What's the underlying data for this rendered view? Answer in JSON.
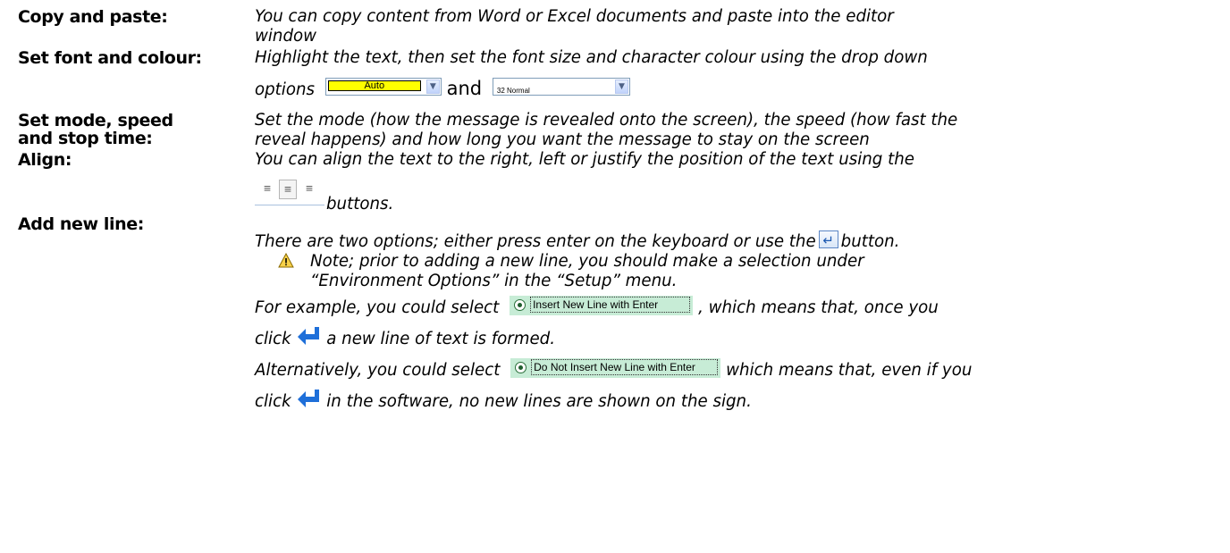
{
  "items": [
    {
      "term": "Copy and paste:",
      "desc1": "You can copy content from Word or Excel documents and paste into the editor",
      "desc2": "window"
    },
    {
      "term": "Set font and colour:",
      "desc1": "Highlight the text, then set the font size and character colour using the drop down",
      "desc2_a": "options",
      "desc2_and": "and"
    },
    {
      "term1": "Set mode, speed",
      "term2": "and stop time:",
      "desc1": "Set the mode (how the message is revealed onto the screen), the speed (how fast the",
      "desc2": "reveal happens) and how long you want the message to stay on the screen"
    },
    {
      "term": "Align:",
      "desc1": "You can align the text to the right, left or justify the position of the text using the",
      "desc2": "buttons."
    },
    {
      "term": "Add new line:",
      "desc1_a": "There are two options; either press enter on the keyboard or use the",
      "desc1_b": "button."
    }
  ],
  "controls": {
    "colour_dropdown_value": "Auto",
    "colour_dropdown_color": "#ffff00",
    "size_dropdown_value": "32 Normal",
    "align_icons": [
      "align-left-icon",
      "align-center-icon",
      "align-right-icon"
    ]
  },
  "note": {
    "line1": "Note; prior to adding a new line, you should make a selection under",
    "line2": "“Environment Options” in the “Setup” menu."
  },
  "examples": {
    "ex1_a": "For example, you could select",
    "ex1_option": "Insert New Line with Enter",
    "ex1_b": ", which means that, once you",
    "ex2_a": "click",
    "ex2_b": "a new line of text is formed.",
    "ex3_a": "Alternatively, you could select",
    "ex3_option": "Do Not Insert New Line with Enter",
    "ex3_b": "which means that, even if you",
    "ex4_a": "click",
    "ex4_b": "in the software, no new lines are shown on the sign."
  },
  "accent_colors": {
    "option_background": "#c7ecd6",
    "enter_arrow": "#1e6fd9"
  }
}
